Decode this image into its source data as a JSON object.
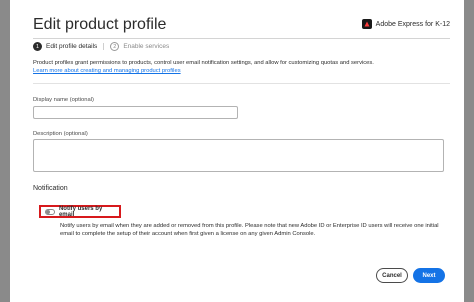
{
  "dialog": {
    "title": "Edit product profile",
    "app_name": "Adobe Express for K-12"
  },
  "steps": [
    {
      "number": "1",
      "label": "Edit profile details",
      "active": true
    },
    {
      "number": "2",
      "label": "Enable services",
      "active": false
    }
  ],
  "intro": {
    "text": "Product profiles grant permissions to products, control user email notification settings, and allow for customizing quotas and services.",
    "link": "Learn more about creating and managing product profiles"
  },
  "fields": {
    "display_name_label": "Display name (optional)",
    "display_name_value": "",
    "description_label": "Description (optional)",
    "description_value": ""
  },
  "notification": {
    "section_title": "Notification",
    "toggle_label": "Notify users by email",
    "toggle_on": false,
    "description": "Notify users by email when they are added or removed from this profile. Please note that new Adobe ID or Enterprise ID users will receive one initial email to complete the setup of their account when first given a license on any given Admin Console."
  },
  "footer": {
    "cancel_label": "Cancel",
    "next_label": "Next"
  },
  "colors": {
    "accent": "#1473e6",
    "highlight_box": "#d7191c"
  }
}
